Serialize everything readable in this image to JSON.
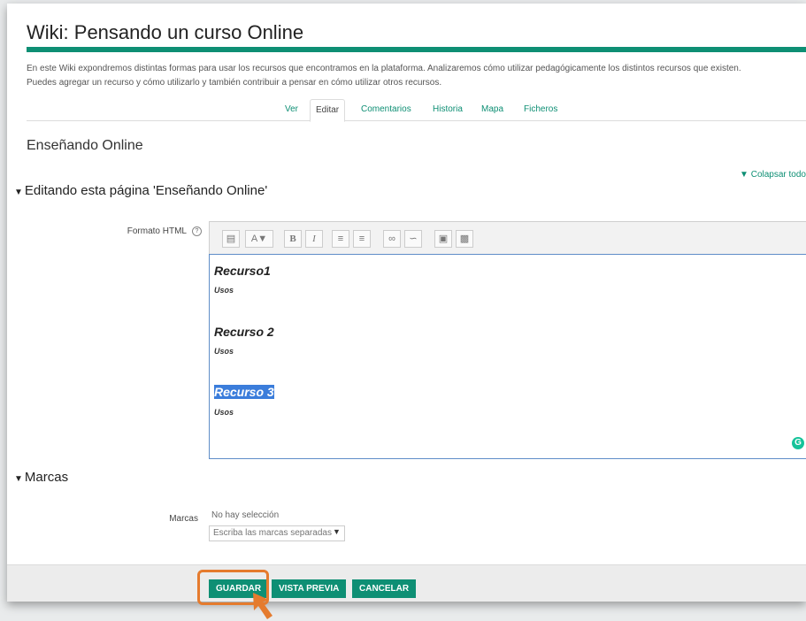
{
  "header": {
    "title": "Wiki: Pensando un curso Online",
    "intro_line1": "En este Wiki expondremos distintas formas para usar los recursos que encontramos en la plataforma. Analizaremos cómo utilizar pedagógicamente los distintos recursos que existen.",
    "intro_line2": "Puedes agregar un recurso y cómo utilizarlo y también contribuir a pensar en cómo utilizar otros recursos."
  },
  "tabs": [
    "Ver",
    "Editar",
    "Comentarios",
    "Historia",
    "Mapa",
    "Ficheros"
  ],
  "page": {
    "section_title": "Enseñando Online",
    "collapse_all": "Colapsar todo",
    "editing_legend": "Editando esta página 'Enseñando Online'"
  },
  "editor": {
    "format_label": "Formato HTML",
    "toolbar_icons": [
      "toggle-toolbar-icon",
      "font-style-icon",
      "bold-icon",
      "italic-icon",
      "bullet-list-icon",
      "numbered-list-icon",
      "link-icon",
      "unlink-icon",
      "image-icon",
      "media-icon"
    ],
    "content": [
      {
        "heading": "Recurso1",
        "sub": "Usos"
      },
      {
        "heading": "Recurso 2",
        "sub": "Usos"
      },
      {
        "heading": "Recurso 3",
        "sub": "Usos"
      }
    ]
  },
  "tags": {
    "legend": "Marcas",
    "label": "Marcas",
    "selection": "No hay selección",
    "placeholder": "Escriba las marcas separadas"
  },
  "buttons": {
    "save": "GUARDAR",
    "preview": "VISTA PREVIA",
    "cancel": "CANCELAR"
  },
  "colors": {
    "accent": "#0e8f74",
    "highlight": "#e57b2e",
    "selection": "#3b7ddb"
  }
}
